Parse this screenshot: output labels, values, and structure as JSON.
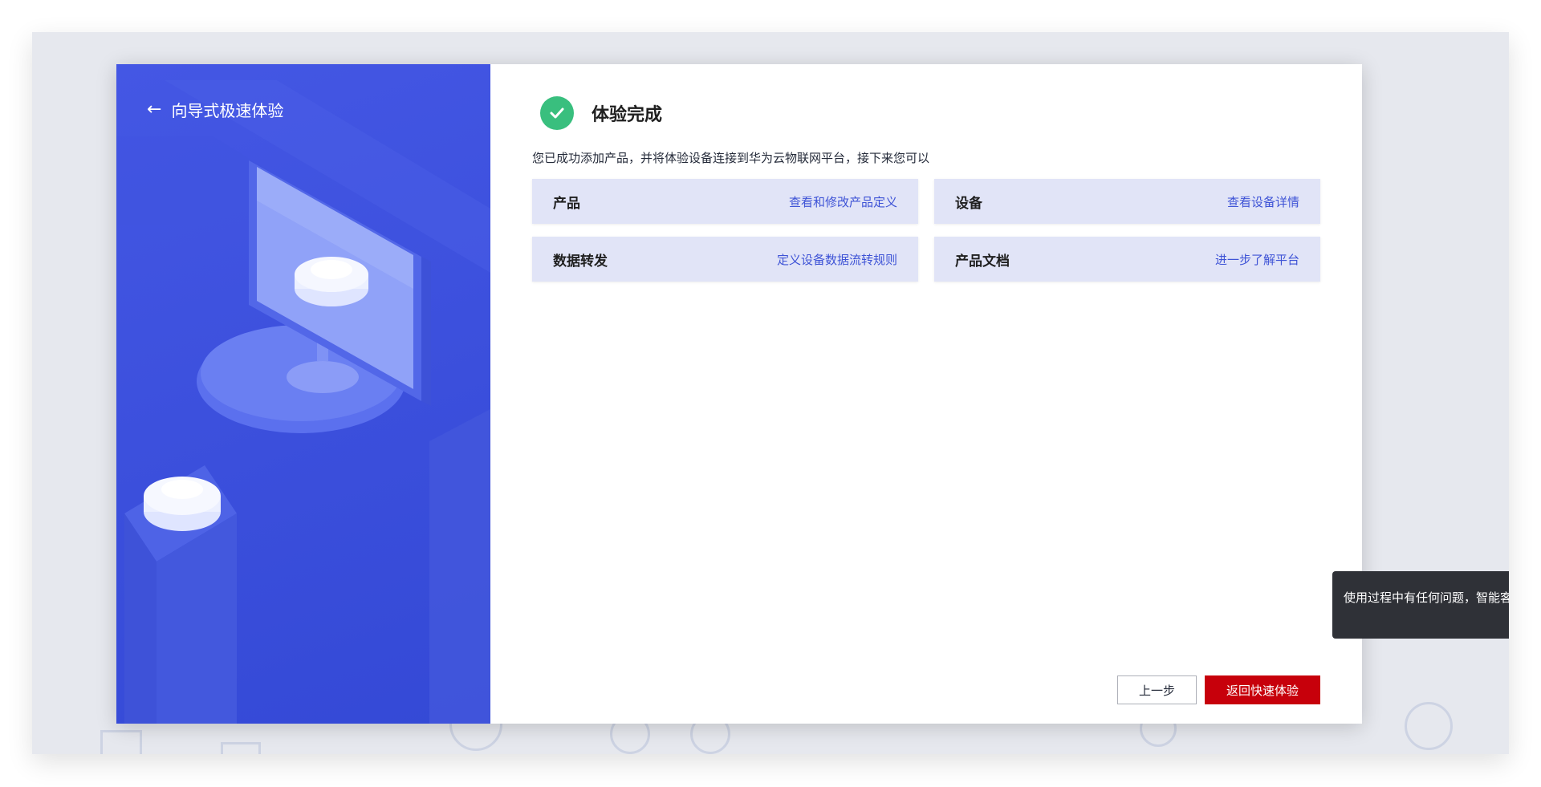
{
  "sidebar": {
    "back_label": "向导式极速体验"
  },
  "main": {
    "title": "体验完成",
    "description": "您已成功添加产品，并将体验设备连接到华为云物联网平台，接下来您可以",
    "cards": [
      {
        "title": "产品",
        "link": "查看和修改产品定义"
      },
      {
        "title": "设备",
        "link": "查看设备详情"
      },
      {
        "title": "数据转发",
        "link": "定义设备数据流转规则"
      },
      {
        "title": "产品文档",
        "link": "进一步了解平台"
      }
    ]
  },
  "footer": {
    "prev_label": "上一步",
    "primary_label": "返回快速体验"
  },
  "toast": {
    "text": "使用过程中有任何问题，智能客"
  },
  "colors": {
    "sidebar_blue": "#3b4fdc",
    "success_green": "#39bf7e",
    "link_blue": "#3e53d6",
    "primary_red": "#c7000b"
  }
}
